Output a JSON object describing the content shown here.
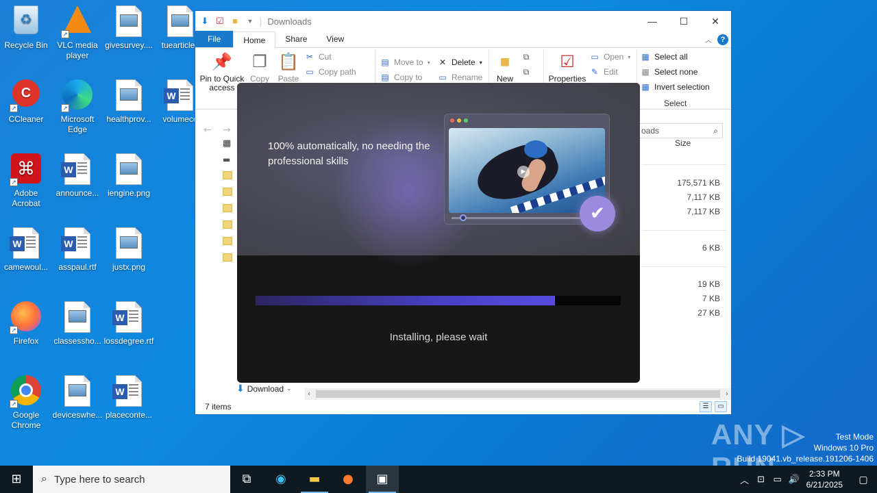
{
  "desktop": {
    "icons": [
      {
        "label": "Recycle Bin",
        "icon": "recycle-bin-icon"
      },
      {
        "label": "VLC media player",
        "icon": "vlc-icon"
      },
      {
        "label": "givesurvey....",
        "icon": "image-file-icon"
      },
      {
        "label": "tuearticle.j",
        "icon": "image-file-icon"
      },
      {
        "label": "CCleaner",
        "icon": "ccleaner-icon"
      },
      {
        "label": "Microsoft Edge",
        "icon": "edge-icon"
      },
      {
        "label": "healthprov...",
        "icon": "image-file-icon"
      },
      {
        "label": "volumeco",
        "icon": "word-file-icon"
      },
      {
        "label": "Adobe Acrobat",
        "icon": "acrobat-icon"
      },
      {
        "label": "announce...",
        "icon": "word-file-icon"
      },
      {
        "label": "iengine.png",
        "icon": "image-file-icon"
      },
      {
        "label": "camewoul...",
        "icon": "word-file-icon"
      },
      {
        "label": "asspaul.rtf",
        "icon": "word-file-icon"
      },
      {
        "label": "justx.png",
        "icon": "image-file-icon"
      },
      {
        "label": "Firefox",
        "icon": "firefox-icon"
      },
      {
        "label": "classessho...",
        "icon": "image-file-icon"
      },
      {
        "label": "lossdegree.rtf",
        "icon": "word-file-icon"
      },
      {
        "label": "Google Chrome",
        "icon": "chrome-icon"
      },
      {
        "label": "deviceswhe...",
        "icon": "image-file-icon"
      },
      {
        "label": "placeconte...",
        "icon": "word-file-icon"
      }
    ]
  },
  "explorer": {
    "title": "Downloads",
    "tabs": {
      "file": "File",
      "home": "Home",
      "share": "Share",
      "view": "View"
    },
    "ribbon": {
      "pin": "Pin to Quick access",
      "copy": "Copy",
      "paste": "Paste",
      "cut": "Cut",
      "copy_path": "Copy path",
      "move_to": "Move to",
      "copy_to": "Copy to",
      "delete": "Delete",
      "rename": "Rename",
      "new": "New",
      "properties": "Properties",
      "open": "Open",
      "edit": "Edit",
      "select_all": "Select all",
      "select_none": "Select none",
      "invert_selection": "Invert selection",
      "select_group": "Select"
    },
    "search_placeholder": "oads",
    "size_header": "Size",
    "sizes": [
      "175,571 KB",
      "7,117 KB",
      "7,117 KB",
      "6 KB",
      "19 KB",
      "7 KB",
      "27 KB"
    ],
    "nav_item": "Download",
    "status": "7 items"
  },
  "installer": {
    "headline": "100% automatically, no needing the professional skills",
    "progress": 0.82,
    "status": "Installing, please wait"
  },
  "watermark": {
    "logo": "ANY RUN",
    "line1": "Test Mode",
    "line2": "Windows 10 Pro",
    "line3": "Build 19041.vb_release.191206-1406"
  },
  "taskbar": {
    "search_placeholder": "Type here to search",
    "time": "2:33 PM",
    "date": "6/21/2025"
  },
  "colors": {
    "accent": "#1979ca",
    "progress": "#5a4be0",
    "desktop": "#0d8ae0"
  }
}
